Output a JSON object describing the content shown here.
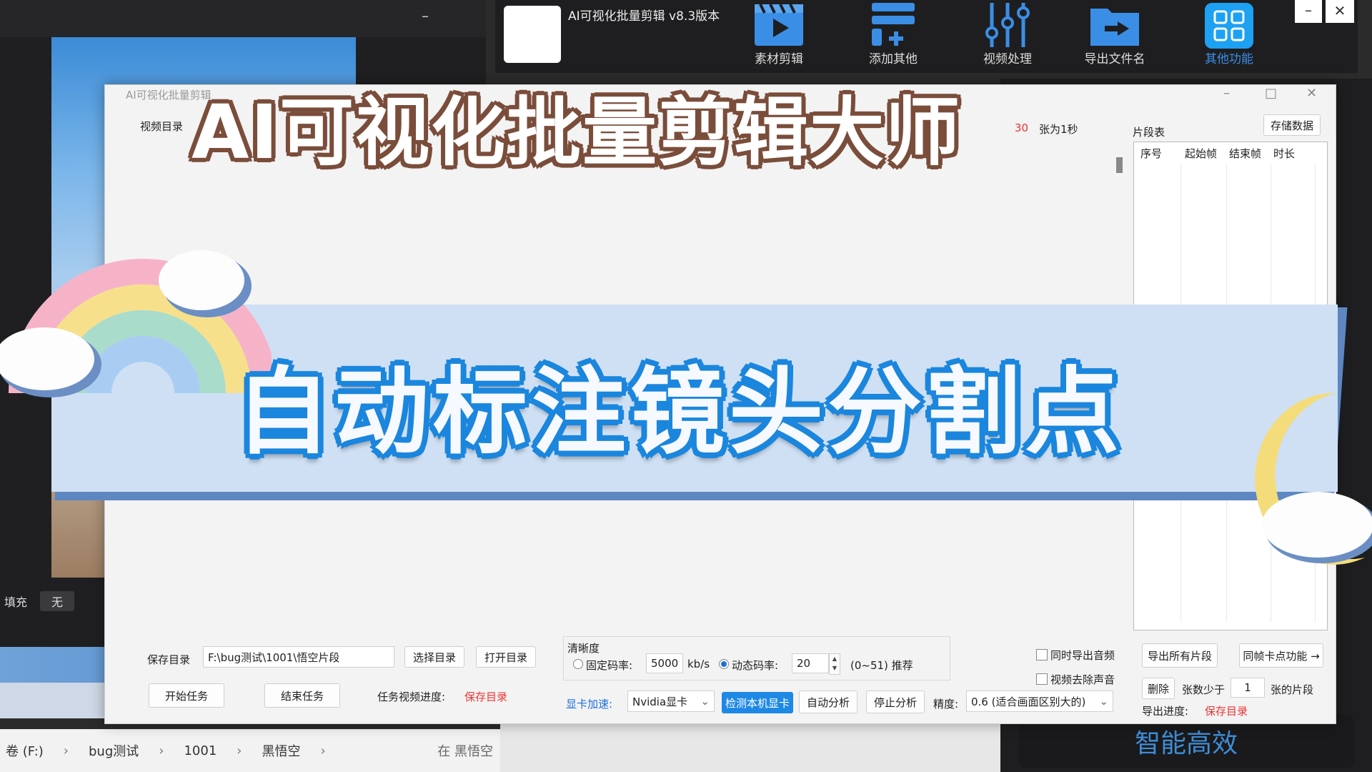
{
  "background": {
    "left_fill_label": "填充",
    "left_fill_value": "无",
    "explorer": {
      "drive": "卷 (F:)",
      "path": [
        "bug测试",
        "1001",
        "黑悟空"
      ],
      "search_prefix": "在 黑悟空"
    },
    "smart_label": "智能高效"
  },
  "toolbar": {
    "app_title": "AI可视化批量剪辑 v8.3版本",
    "tools": [
      {
        "label": "素材剪辑",
        "icon": "film-play-icon"
      },
      {
        "label": "添加其他",
        "icon": "add-layers-icon"
      },
      {
        "label": "视频处理",
        "icon": "sliders-icon"
      },
      {
        "label": "导出文件名",
        "icon": "folder-export-icon"
      },
      {
        "label": "其他功能",
        "icon": "grid-apps-icon"
      }
    ],
    "minimize": "–",
    "close": "✕"
  },
  "window": {
    "title": "AI可视化批量剪辑",
    "minimize": "–",
    "maximize": "□",
    "close": "✕",
    "video_dir_label": "视频目录",
    "frames_value": "30",
    "frames_suffix": "张为1秒",
    "segment_table_label": "片段表",
    "store_button": "存储数据",
    "segment_columns": [
      "序号",
      "起始帧",
      "结束帧",
      "时长"
    ],
    "save_dir_label": "保存目录",
    "save_dir_value": "F:\\bug测试\\1001\\悟空片段",
    "choose_dir_button": "选择目录",
    "open_dir_button": "打开目录",
    "start_button": "开始任务",
    "end_button": "结束任务",
    "task_progress_label": "任务视频进度:",
    "task_progress_value": "保存目录",
    "clarity_label": "清晰度",
    "fixed_bitrate_label": "固定码率:",
    "fixed_bitrate_value": "5000",
    "bitrate_unit": "kb/s",
    "dynamic_bitrate_label": "动态码率:",
    "dynamic_bitrate_value": "20",
    "range_hint": "(0~51) 推荐",
    "gpu_label": "显卡加速:",
    "gpu_value": "Nvidia显卡",
    "detect_gpu_button": "检测本机显卡",
    "auto_analyze_button": "自动分析",
    "stop_analyze_button": "停止分析",
    "precision_label": "精度:",
    "precision_value": "0.6 (适合画面区别大的)",
    "export_audio_label": "同时导出音频",
    "remove_audio_label": "视频去除声音",
    "export_all_button": "导出所有片段",
    "same_frame_button": "同帧卡点功能 →",
    "delete_button": "删除",
    "count_less_label": "张数少于",
    "count_value": "1",
    "count_suffix": "张的片段",
    "export_progress_label": "导出进度:",
    "export_progress_value": "保存目录"
  },
  "overlay": {
    "headline": "AI可视化批量剪辑大师",
    "banner": "自动标注镜头分割点"
  },
  "colors": {
    "accent_blue": "#1e88e5",
    "banner_outline": "#1b86dd",
    "headline_outline": "#7a4d3b",
    "warning_red": "#e33333"
  }
}
